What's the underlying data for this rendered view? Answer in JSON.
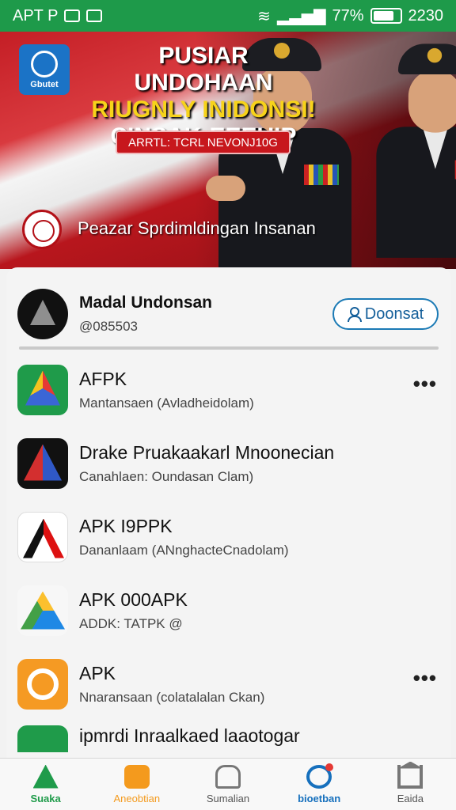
{
  "status_bar": {
    "carrier": "APT P",
    "battery": "77%",
    "time": "2230",
    "battery_level": 0.77
  },
  "banner": {
    "logo_text": "Gbutet",
    "headline_1": "PUSIAR UNDOHAAN",
    "headline_2": "RIUGNLY INIDONSI!",
    "headline_3": "CINSAK-EEEUIP",
    "tag": "ARRTL: TCRL NEVONJ10G",
    "subtitle": "Peazar Sprdimldingan Insanan",
    "colors": {
      "red": "#c41e25",
      "yellow": "#f7d31a"
    }
  },
  "profile": {
    "name": "Madal Undonsan",
    "handle": "@085503",
    "follow_label": "Doonsat",
    "accent": "#1b7ab5"
  },
  "apps": [
    {
      "name": "AFPK",
      "desc": "Mantansaen (Avladheidolam)",
      "icon": "colorful-triangle-icon",
      "more": true
    },
    {
      "name": "Drake Pruakaakarl Mnoonecian",
      "desc": "Canahlaen: Oundasan Clam)",
      "icon": "red-blue-triangle-icon",
      "more": false
    },
    {
      "name": "APK I9PPK",
      "desc": "Dananlaam (ANnghacteCnadolam)",
      "icon": "red-black-a-icon",
      "more": false
    },
    {
      "name": "APK 000APK",
      "desc": "ADDK: TATPK @",
      "icon": "drive-icon",
      "more": false
    },
    {
      "name": "APK",
      "desc": "Nnaransaan (colatalalan Ckan)",
      "icon": "orange-gear-icon",
      "more": true
    }
  ],
  "partial_row": "ipmrdi Inraalkaed laaotogar",
  "bottom_nav": [
    {
      "label": "Suaka",
      "icon": "green-triangle-icon"
    },
    {
      "label": "Aneobtian",
      "icon": "orange-square-icon"
    },
    {
      "label": "Sumalian",
      "icon": "person-icon"
    },
    {
      "label": "bioetban",
      "icon": "blue-circle-icon"
    },
    {
      "label": "Eaida",
      "icon": "bank-icon"
    }
  ]
}
